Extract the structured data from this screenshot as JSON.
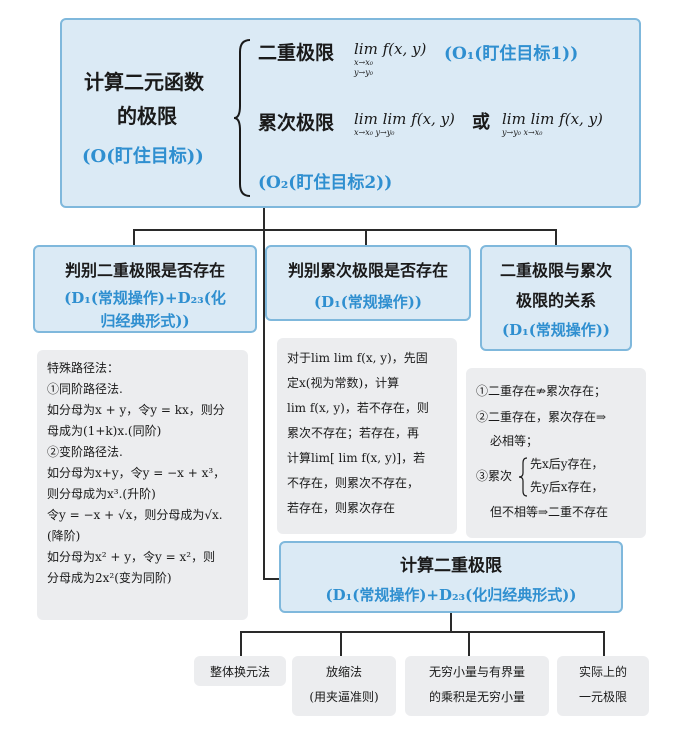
{
  "main": {
    "title_line1": "计算二元函数",
    "title_line2": "的极限",
    "title_tag": "(O(盯住目标))",
    "row1_label": "二重极限",
    "row1_expr": "lim f(x, y)",
    "row1_sub1": "x→x₀",
    "row1_sub2": "y→y₀",
    "row1_tag": "(O₁(盯住目标1))",
    "row2_label": "累次极限",
    "row2_expr_a": "lim lim f(x, y)",
    "row2_sub_a": "x→x₀ y→y₀",
    "row2_or": "或",
    "row2_expr_b": "lim lim f(x, y)",
    "row2_sub_b": "y→y₀ x→x₀",
    "row2_tag": "(O₂(盯住目标2))"
  },
  "box_a": {
    "title": "判别二重极限是否存在",
    "tag_line1": "(D₁(常规操作)+D₂₃(化",
    "tag_line2": "归经典形式))"
  },
  "box_b": {
    "title": "判别累次极限是否存在",
    "tag": "(D₁(常规操作))"
  },
  "box_c": {
    "title_line1": "二重极限与累次",
    "title_line2": "极限的关系",
    "tag": "(D₁(常规操作))"
  },
  "panel_a": {
    "lines": [
      "特殊路径法：",
      "①同阶路径法.",
      "如分母为x + y，令y = kx，则分",
      "母成为(1+k)x.(同阶)",
      "②变阶路径法.",
      "如分母为x+y，令y = −x + x³，",
      "则分母成为x³.(升阶)",
      "令y = −x + √x，则分母成为√x.",
      "(降阶)",
      "如分母为x² + y，令y = x²，则",
      "分母成为2x²(变为同阶)"
    ]
  },
  "panel_b": {
    "lines": [
      "对于lim lim f(x, y)，先固",
      "定x(视为常数)，计算",
      "lim f(x, y)，若不存在，则",
      "累次不存在；若存在，再",
      "计算lim[ lim f(x, y)]，若",
      "不存在，则累次不存在，",
      "若存在，则累次存在"
    ]
  },
  "panel_c": {
    "line1": "①二重存在⇏累次存在；",
    "line2a": "②二重存在，累次存在⇒",
    "line2b": "必相等；",
    "line3_prefix": "③累次",
    "line3a": "先x后y存在，",
    "line3b": "先y后x存在，",
    "line4": "但不相等⇒二重不存在"
  },
  "box_d": {
    "title": "计算二重极限",
    "tag": "(D₁(常规操作)+D₂₃(化归经典形式))"
  },
  "methods": [
    {
      "line1": "整体换元法",
      "line2": ""
    },
    {
      "line1": "放缩法",
      "line2": "(用夹逼准则)"
    },
    {
      "line1": "无穷小量与有界量",
      "line2": "的乘积是无穷小量"
    },
    {
      "line1": "实际上的",
      "line2": "一元极限"
    }
  ]
}
